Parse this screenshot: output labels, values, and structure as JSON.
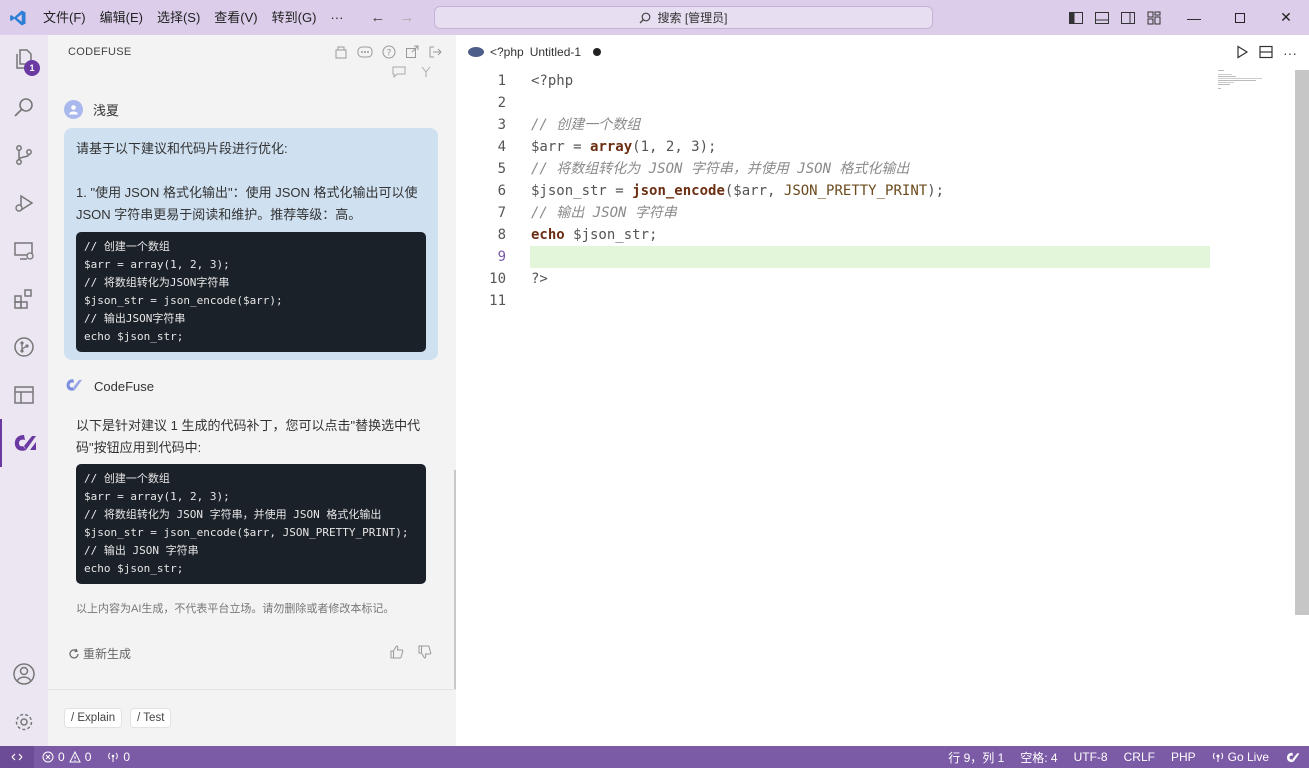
{
  "titlebar": {
    "menu": [
      "文件(F)",
      "编辑(E)",
      "选择(S)",
      "查看(V)",
      "转到(G)",
      "···"
    ],
    "search": "搜索 [管理员]"
  },
  "panel": {
    "title": "CODEFUSE",
    "user_name": "浅夏",
    "request_intro": "请基于以下建议和代码片段进行优化:",
    "request_suggestion": "1. \"使用 JSON 格式化输出\"：使用 JSON 格式化输出可以使 JSON 字符串更易于阅读和维护。推荐等级：高。",
    "request_code": [
      "// 创建一个数组",
      "$arr = array(1, 2, 3);",
      "// 将数组转化为JSON字符串",
      "$json_str = json_encode($arr);",
      "// 输出JSON字符串",
      "echo $json_str;"
    ],
    "bot_name": "CodeFuse",
    "answer_text": "以下是针对建议 1 生成的代码补丁，您可以点击\"替换选中代码\"按钮应用到代码中:",
    "answer_code": [
      "// 创建一个数组",
      "$arr = array(1, 2, 3);",
      "// 将数组转化为 JSON 字符串，并使用 JSON 格式化输出",
      "$json_str = json_encode($arr, JSON_PRETTY_PRINT);",
      "// 输出 JSON 字符串",
      "echo $json_str;"
    ],
    "disclaimer": "以上内容为AI生成，不代表平台立场。请勿删除或者修改本标记。",
    "regenerate": "重新生成",
    "chips": [
      "/ Explain",
      "/ Test"
    ]
  },
  "editor": {
    "tab_icon": "<?php",
    "tab_title": "Untitled-1",
    "line_numbers": [
      "1",
      "2",
      "3",
      "4",
      "5",
      "6",
      "7",
      "8",
      "9",
      "10",
      "11"
    ],
    "code_lines": [
      "<?php",
      "",
      "// 创建一个数组",
      "$arr = array(1, 2, 3);",
      "// 将数组转化为 JSON 字符串，并使用 JSON 格式化输出",
      "$json_str = json_encode($arr, JSON_PRETTY_PRINT);",
      "// 输出 JSON 字符串",
      "echo $json_str;",
      "",
      "?>",
      ""
    ],
    "current_line": 9
  },
  "activity": {
    "explorer_badge": "1"
  },
  "statusbar": {
    "errors": "0",
    "warnings": "0",
    "ports": "0",
    "position": "行 9，列 1",
    "spaces": "空格: 4",
    "encoding": "UTF-8",
    "eol": "CRLF",
    "language": "PHP",
    "golive": "Go Live"
  },
  "colors": {
    "accent": "#7b5aa6",
    "titlebar": "#dccdea",
    "current_line_highlight": "#e3f6d9"
  }
}
